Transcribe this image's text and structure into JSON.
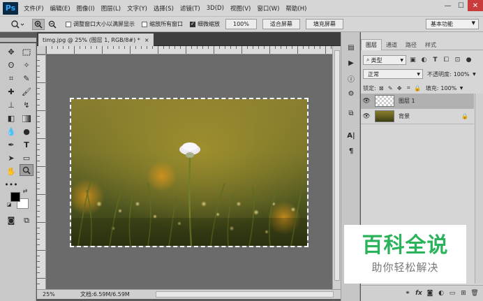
{
  "app": {
    "logo": "Ps"
  },
  "menu": [
    "文件(F)",
    "编辑(E)",
    "图像(I)",
    "图层(L)",
    "文字(Y)",
    "选择(S)",
    "滤镜(T)",
    "3D(D)",
    "视图(V)",
    "窗口(W)",
    "帮助(H)"
  ],
  "window_controls": {
    "minimize": "—",
    "maximize": "☐",
    "close": "✕"
  },
  "options": {
    "zoom_tool_icon": "magnifier-icon",
    "resize_windows_label": "调整窗口大小以满屏显示",
    "resize_windows_checked": false,
    "zoom_all_windows_label": "缩放所有窗口",
    "zoom_all_windows_checked": false,
    "scrubby_zoom_label": "细微缩放",
    "scrubby_zoom_checked": true,
    "zoom_percent": "100%",
    "fit_screen_label": "适合屏幕",
    "fill_screen_label": "填充屏幕",
    "workspace": "基本功能"
  },
  "document": {
    "tab_title": "timg.jpg @ 25% (图层 1, RGB/8#) *",
    "tab_close": "×",
    "zoom": "25%",
    "doc_info": "文档:6.59M/6.59M"
  },
  "swatches": {
    "foreground": "#000000",
    "background": "#ffffff"
  },
  "layers_panel": {
    "tabs": [
      "图层",
      "通道",
      "路径",
      "样式"
    ],
    "active_tab": "图层",
    "kind_filter": "类型",
    "blend_mode": "正常",
    "opacity_label": "不透明度:",
    "opacity": "100%",
    "lock_label": "锁定:",
    "fill_label": "填充:",
    "fill": "100%",
    "layers": [
      {
        "name": "图层 1",
        "visible": true,
        "selected": true,
        "locked": false
      },
      {
        "name": "背景",
        "visible": true,
        "selected": false,
        "locked": true
      }
    ]
  },
  "watermark": {
    "title": "百科全说",
    "subtitle": "助你轻松解决",
    "color": "#2bb35c"
  }
}
